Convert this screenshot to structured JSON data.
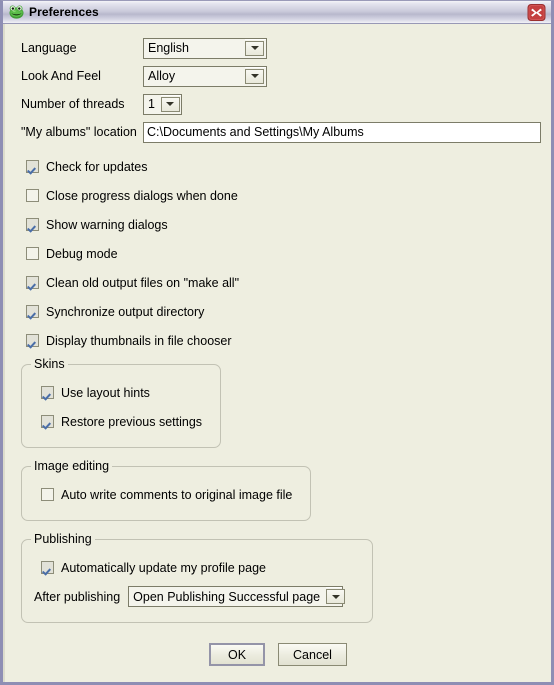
{
  "window": {
    "title": "Preferences",
    "icon": "frog-icon",
    "close_label": "Close",
    "bg_color": "#eeeee0",
    "border_color": "#8e8eb4",
    "close_color": "#c94040"
  },
  "form": {
    "rows": [
      {
        "label": "Language",
        "control": "combo",
        "value": "English"
      },
      {
        "label": "Look And Feel",
        "control": "combo",
        "value": "Alloy"
      },
      {
        "label": "Number of threads",
        "control": "combo",
        "value": "1"
      },
      {
        "label": "\"My albums\" location",
        "control": "textfield",
        "value": "C:\\Documents and Settings\\My Albums"
      }
    ]
  },
  "checkboxes": [
    {
      "label": "Check for updates",
      "checked": true
    },
    {
      "label": "Close progress dialogs when done",
      "checked": false
    },
    {
      "label": "Show warning dialogs",
      "checked": true
    },
    {
      "label": "Debug mode",
      "checked": false
    },
    {
      "label": "Clean old output files on \"make all\"",
      "checked": true
    },
    {
      "label": "Synchronize output directory",
      "checked": true
    },
    {
      "label": "Display thumbnails in file chooser",
      "checked": true
    }
  ],
  "groups": {
    "skins": {
      "title": "Skins",
      "checkboxes": [
        {
          "label": "Use layout hints",
          "checked": true
        },
        {
          "label": "Restore previous settings",
          "checked": true
        }
      ]
    },
    "image_editing": {
      "title": "Image editing",
      "checkboxes": [
        {
          "label": "Auto write comments to original image file",
          "checked": false
        }
      ]
    },
    "publishing": {
      "title": "Publishing",
      "checkboxes": [
        {
          "label": "Automatically update my profile page",
          "checked": true
        }
      ],
      "after_publishing_label": "After publishing",
      "after_publishing_value": "Open Publishing Successful page"
    }
  },
  "buttons": {
    "ok": "OK",
    "cancel": "Cancel"
  }
}
